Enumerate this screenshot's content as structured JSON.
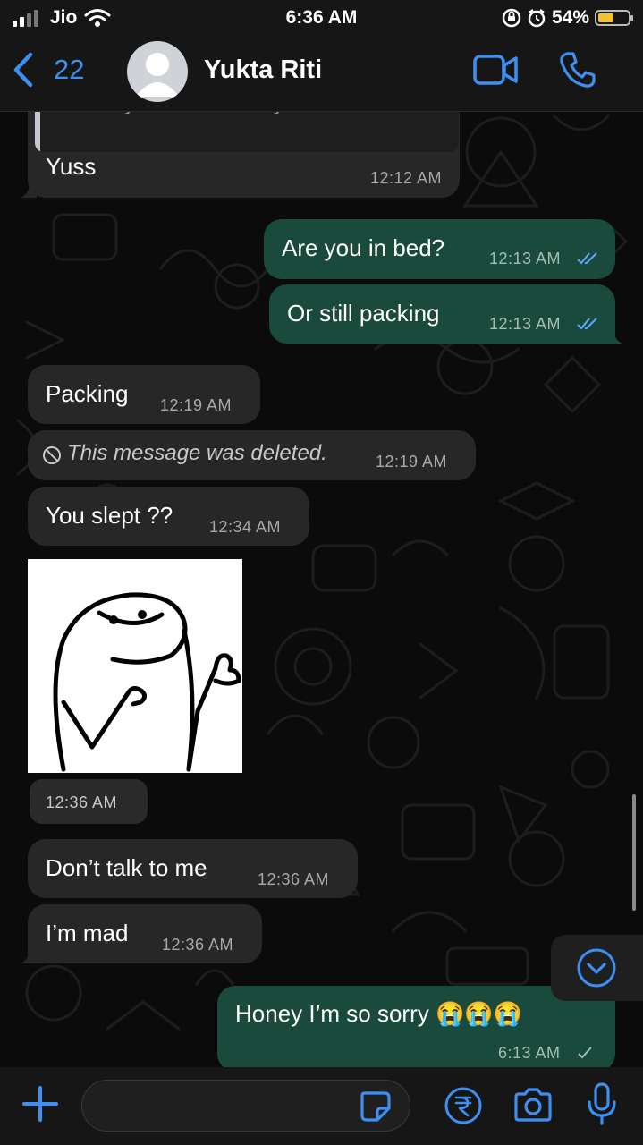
{
  "status_bar": {
    "carrier": "Jio",
    "time": "6:36 AM",
    "battery_percent": "54%",
    "battery_level": 0.54,
    "icons": [
      "signal-icon",
      "wifi-icon",
      "orientation-lock-icon",
      "alarm-icon",
      "battery-icon"
    ]
  },
  "header": {
    "back_count": "22",
    "contact_name": "Yukta Riti",
    "icons": [
      "back-chevron-icon",
      "avatar-icon",
      "video-call-icon",
      "phone-call-icon"
    ],
    "accent_color": "#3d8ff2"
  },
  "messages": [
    {
      "direction": "in",
      "quoted_text": "But do your best while you're there",
      "text": "Yuss",
      "time": "12:12 AM"
    },
    {
      "direction": "out",
      "text": "Are you in bed?",
      "time": "12:13 AM",
      "status": "read"
    },
    {
      "direction": "out",
      "text": "Or still packing",
      "time": "12:13 AM",
      "status": "read"
    },
    {
      "direction": "in",
      "text": "Packing",
      "time": "12:19 AM"
    },
    {
      "direction": "in",
      "deleted": true,
      "text": "This message was deleted.",
      "time": "12:19 AM"
    },
    {
      "direction": "in",
      "text": "You slept ??",
      "time": "12:34 AM"
    },
    {
      "direction": "in",
      "sticker": "thumbs-up-blob-sticker",
      "time": "12:36 AM"
    },
    {
      "direction": "in",
      "text": "Don’t talk to me",
      "time": "12:36 AM"
    },
    {
      "direction": "in",
      "text": "I’m mad",
      "time": "12:36 AM"
    },
    {
      "direction": "out",
      "text": "Honey I’m so sorry 😭😭😭",
      "time": "6:13 AM",
      "status": "sent"
    }
  ],
  "composer": {
    "input_value": "",
    "icons": [
      "plus-icon",
      "sticker-icon",
      "rupee-payment-icon",
      "camera-icon",
      "microphone-icon"
    ]
  },
  "jump_to_bottom_icon": "chevron-down-circle-icon",
  "colors": {
    "incoming_bubble": "#272727",
    "outgoing_bubble": "#1a4a3c",
    "read_tick": "#5aa7ff",
    "sent_tick": "#a4bdb4",
    "background": "#0b0b0b"
  }
}
